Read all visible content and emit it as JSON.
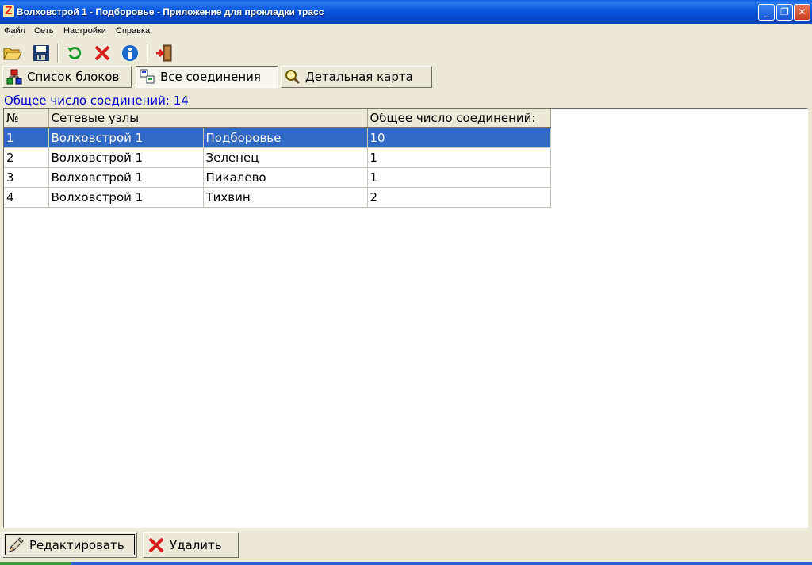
{
  "window": {
    "title": "Волховстрой 1 - Подборовье - Приложение для прокладки трасс",
    "app_icon_glyph": "Z",
    "minimize_glyph": "_",
    "maximize_glyph": "❐",
    "close_glyph": "✕"
  },
  "menu": {
    "file": "Файл",
    "network": "Сеть",
    "settings": "Настройки",
    "help": "Справка"
  },
  "toolbar": {
    "icons": [
      "open-folder-icon",
      "save-icon",
      "refresh-icon",
      "delete-icon",
      "info-icon",
      "exit-icon"
    ]
  },
  "tabs": {
    "blocks": "Список блоков",
    "connections": "Все соединения",
    "map": "Детальная карта",
    "active": "connections"
  },
  "summary": {
    "label": "Общее число соединений: 14"
  },
  "table": {
    "headers": {
      "num": "№",
      "nodes": "Сетевые узлы",
      "count": "Общее число соединений:"
    },
    "rows": [
      {
        "num": "1",
        "from": "Волховстрой 1",
        "to": "Подборовье",
        "count": "10",
        "selected": true
      },
      {
        "num": "2",
        "from": "Волховстрой 1",
        "to": "Зеленец",
        "count": "1"
      },
      {
        "num": "3",
        "from": "Волховстрой 1",
        "to": "Пикалево",
        "count": "1"
      },
      {
        "num": "4",
        "from": "Волховстрой 1",
        "to": "Тихвин",
        "count": "2"
      }
    ]
  },
  "buttons": {
    "edit": "Редактировать",
    "delete": "Удалить"
  },
  "colors": {
    "selection": "#316AC5",
    "summary_text": "#0000CC",
    "window_bg": "#ECE9D8"
  }
}
